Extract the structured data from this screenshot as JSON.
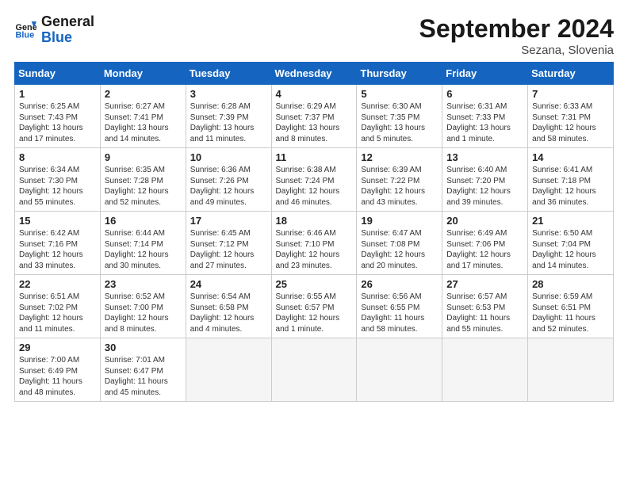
{
  "header": {
    "logo_line1": "General",
    "logo_line2": "Blue",
    "month": "September 2024",
    "location": "Sezana, Slovenia"
  },
  "days_of_week": [
    "Sunday",
    "Monday",
    "Tuesday",
    "Wednesday",
    "Thursday",
    "Friday",
    "Saturday"
  ],
  "weeks": [
    [
      {
        "day": "1",
        "sunrise": "6:25 AM",
        "sunset": "7:43 PM",
        "daylight": "13 hours and 17 minutes."
      },
      {
        "day": "2",
        "sunrise": "6:27 AM",
        "sunset": "7:41 PM",
        "daylight": "13 hours and 14 minutes."
      },
      {
        "day": "3",
        "sunrise": "6:28 AM",
        "sunset": "7:39 PM",
        "daylight": "13 hours and 11 minutes."
      },
      {
        "day": "4",
        "sunrise": "6:29 AM",
        "sunset": "7:37 PM",
        "daylight": "13 hours and 8 minutes."
      },
      {
        "day": "5",
        "sunrise": "6:30 AM",
        "sunset": "7:35 PM",
        "daylight": "13 hours and 5 minutes."
      },
      {
        "day": "6",
        "sunrise": "6:31 AM",
        "sunset": "7:33 PM",
        "daylight": "13 hours and 1 minute."
      },
      {
        "day": "7",
        "sunrise": "6:33 AM",
        "sunset": "7:31 PM",
        "daylight": "12 hours and 58 minutes."
      }
    ],
    [
      {
        "day": "8",
        "sunrise": "6:34 AM",
        "sunset": "7:30 PM",
        "daylight": "12 hours and 55 minutes."
      },
      {
        "day": "9",
        "sunrise": "6:35 AM",
        "sunset": "7:28 PM",
        "daylight": "12 hours and 52 minutes."
      },
      {
        "day": "10",
        "sunrise": "6:36 AM",
        "sunset": "7:26 PM",
        "daylight": "12 hours and 49 minutes."
      },
      {
        "day": "11",
        "sunrise": "6:38 AM",
        "sunset": "7:24 PM",
        "daylight": "12 hours and 46 minutes."
      },
      {
        "day": "12",
        "sunrise": "6:39 AM",
        "sunset": "7:22 PM",
        "daylight": "12 hours and 43 minutes."
      },
      {
        "day": "13",
        "sunrise": "6:40 AM",
        "sunset": "7:20 PM",
        "daylight": "12 hours and 39 minutes."
      },
      {
        "day": "14",
        "sunrise": "6:41 AM",
        "sunset": "7:18 PM",
        "daylight": "12 hours and 36 minutes."
      }
    ],
    [
      {
        "day": "15",
        "sunrise": "6:42 AM",
        "sunset": "7:16 PM",
        "daylight": "12 hours and 33 minutes."
      },
      {
        "day": "16",
        "sunrise": "6:44 AM",
        "sunset": "7:14 PM",
        "daylight": "12 hours and 30 minutes."
      },
      {
        "day": "17",
        "sunrise": "6:45 AM",
        "sunset": "7:12 PM",
        "daylight": "12 hours and 27 minutes."
      },
      {
        "day": "18",
        "sunrise": "6:46 AM",
        "sunset": "7:10 PM",
        "daylight": "12 hours and 23 minutes."
      },
      {
        "day": "19",
        "sunrise": "6:47 AM",
        "sunset": "7:08 PM",
        "daylight": "12 hours and 20 minutes."
      },
      {
        "day": "20",
        "sunrise": "6:49 AM",
        "sunset": "7:06 PM",
        "daylight": "12 hours and 17 minutes."
      },
      {
        "day": "21",
        "sunrise": "6:50 AM",
        "sunset": "7:04 PM",
        "daylight": "12 hours and 14 minutes."
      }
    ],
    [
      {
        "day": "22",
        "sunrise": "6:51 AM",
        "sunset": "7:02 PM",
        "daylight": "12 hours and 11 minutes."
      },
      {
        "day": "23",
        "sunrise": "6:52 AM",
        "sunset": "7:00 PM",
        "daylight": "12 hours and 8 minutes."
      },
      {
        "day": "24",
        "sunrise": "6:54 AM",
        "sunset": "6:58 PM",
        "daylight": "12 hours and 4 minutes."
      },
      {
        "day": "25",
        "sunrise": "6:55 AM",
        "sunset": "6:57 PM",
        "daylight": "12 hours and 1 minute."
      },
      {
        "day": "26",
        "sunrise": "6:56 AM",
        "sunset": "6:55 PM",
        "daylight": "11 hours and 58 minutes."
      },
      {
        "day": "27",
        "sunrise": "6:57 AM",
        "sunset": "6:53 PM",
        "daylight": "11 hours and 55 minutes."
      },
      {
        "day": "28",
        "sunrise": "6:59 AM",
        "sunset": "6:51 PM",
        "daylight": "11 hours and 52 minutes."
      }
    ],
    [
      {
        "day": "29",
        "sunrise": "7:00 AM",
        "sunset": "6:49 PM",
        "daylight": "11 hours and 48 minutes."
      },
      {
        "day": "30",
        "sunrise": "7:01 AM",
        "sunset": "6:47 PM",
        "daylight": "11 hours and 45 minutes."
      },
      null,
      null,
      null,
      null,
      null
    ]
  ]
}
